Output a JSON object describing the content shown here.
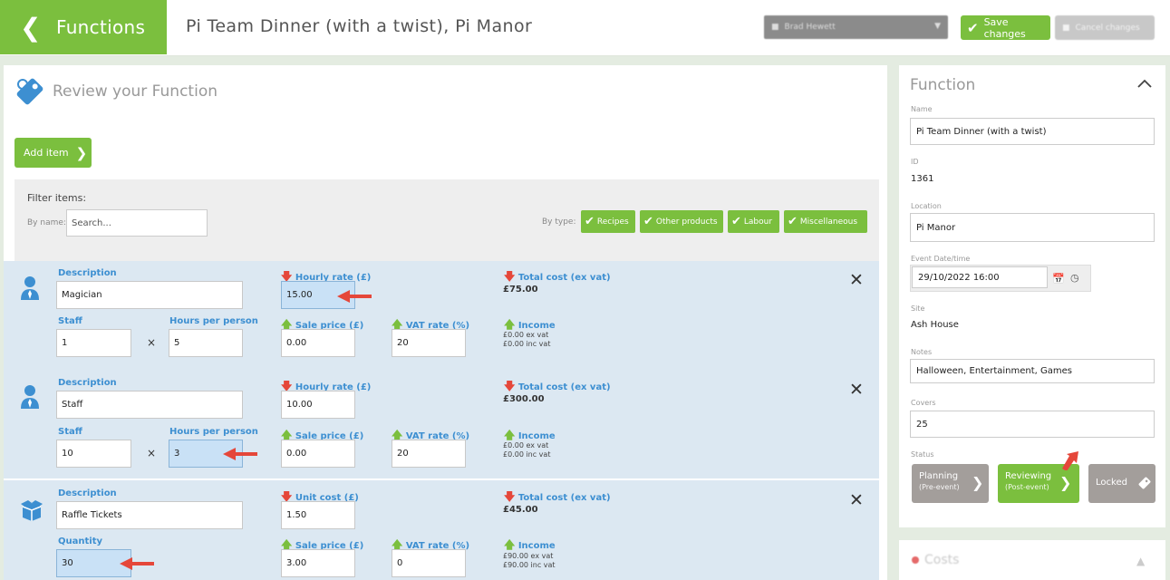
{
  "header": {
    "back_label": "Functions",
    "title": "Pi Team Dinner (with a twist), Pi Manor",
    "user_select": "Brad Hewett",
    "save_label": "Save changes",
    "cancel_label": "Cancel changes"
  },
  "main": {
    "section_title": "Review your Function",
    "add_item_label": "Add item",
    "filter": {
      "title": "Filter items:",
      "by_name_label": "By name:",
      "search_placeholder": "Search...",
      "by_type_label": "By type:",
      "types": [
        "Recipes",
        "Other products",
        "Labour",
        "Miscellaneous"
      ]
    },
    "items": [
      {
        "description_label": "Description",
        "description": "Magician",
        "rate_label": "Hourly rate (£)",
        "rate": "15.00",
        "total_label": "Total cost (ex vat)",
        "total": "£75.00",
        "staff_label": "Staff",
        "staff": "1",
        "hours_label": "Hours per person",
        "hours": "5",
        "sale_label": "Sale price (£)",
        "sale": "0.00",
        "vat_label": "VAT rate (%)",
        "vat": "20",
        "income_label": "Income",
        "income_ex": "£0.00 ex vat",
        "income_inc": "£0.00 inc vat"
      },
      {
        "description_label": "Description",
        "description": "Staff",
        "rate_label": "Hourly rate (£)",
        "rate": "10.00",
        "total_label": "Total cost (ex vat)",
        "total": "£300.00",
        "staff_label": "Staff",
        "staff": "10",
        "hours_label": "Hours per person",
        "hours": "3",
        "sale_label": "Sale price (£)",
        "sale": "0.00",
        "vat_label": "VAT rate (%)",
        "vat": "20",
        "income_label": "Income",
        "income_ex": "£0.00 ex vat",
        "income_inc": "£0.00 inc vat"
      },
      {
        "description_label": "Description",
        "description": "Raffle Tickets",
        "rate_label": "Unit cost (£)",
        "rate": "1.50",
        "total_label": "Total cost (ex vat)",
        "total": "£45.00",
        "quantity_label": "Quantity",
        "quantity": "30",
        "sale_label": "Sale price (£)",
        "sale": "3.00",
        "vat_label": "VAT rate (%)",
        "vat": "0",
        "income_label": "Income",
        "income_ex": "£90.00 ex vat",
        "income_inc": "£90.00 inc vat"
      }
    ]
  },
  "sidebar": {
    "heading": "Function",
    "name_label": "Name",
    "name": "Pi Team Dinner (with a twist)",
    "id_label": "ID",
    "id": "1361",
    "location_label": "Location",
    "location": "Pi Manor",
    "event_label": "Event Date/time",
    "event": "29/10/2022 16:00",
    "site_label": "Site",
    "site": "Ash House",
    "notes_label": "Notes",
    "notes": "Halloween, Entertainment, Games",
    "covers_label": "Covers",
    "covers": "25",
    "status_label": "Status",
    "status": [
      {
        "label": "Planning",
        "sub": "(Pre-event)"
      },
      {
        "label": "Reviewing",
        "sub": "(Post-event)"
      },
      {
        "label": "Locked"
      }
    ],
    "costs_heading": "Costs"
  },
  "colors": {
    "green": "#7bbf3e",
    "blue": "#3d8fd1",
    "red": "#e5473a",
    "grey_button": "#a39e9b",
    "item_bg": "#dce8f2"
  }
}
